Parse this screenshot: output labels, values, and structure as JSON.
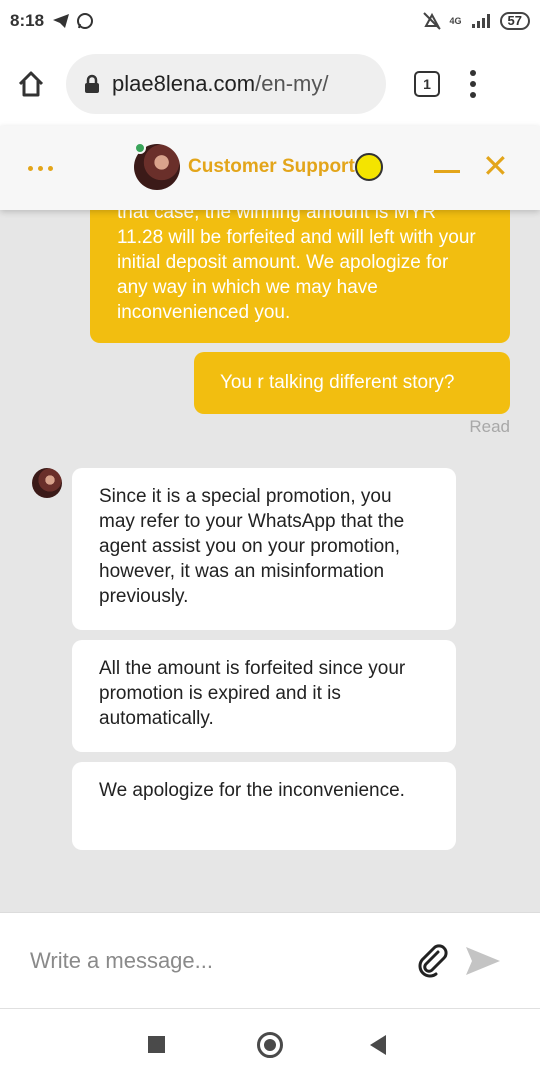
{
  "status_bar": {
    "time": "8:18",
    "network": "4G",
    "battery": "57"
  },
  "browser": {
    "url_domain": "plae8lena.com",
    "url_path": "/en-my/",
    "tab_count": "1"
  },
  "chat_header": {
    "title": "Customer Support"
  },
  "messages": {
    "outgoing_1": "that case, the winning amount is MYR 11.28 will be forfeited and will left with your initial deposit amount. We apologize for any way in which we may have inconvenienced you.",
    "outgoing_2": "You r talking different story?",
    "read_status": "Read",
    "incoming_1": "Since it is a special promotion, you may refer to your WhatsApp that the agent assist you on your promotion, however, it was an misinformation previously.",
    "incoming_2": "All the amount is forfeited since your promotion is expired and it is automatically.",
    "incoming_3": "We apologize for the inconvenience."
  },
  "composer": {
    "placeholder": "Write a message..."
  },
  "icons": {
    "status": [
      "telegram-icon",
      "whatsapp-icon",
      "mute-icon",
      "signal-icon",
      "battery-icon"
    ],
    "browser": [
      "home-icon",
      "lock-icon",
      "tabs-icon",
      "menu-icon"
    ],
    "chat": [
      "more-icon",
      "minimize-icon",
      "close-icon",
      "attach-icon",
      "send-icon"
    ],
    "nav": [
      "recents-icon",
      "home-nav-icon",
      "back-icon"
    ]
  },
  "colors": {
    "accent": "#e3a51a",
    "outgoing_bubble": "#f2be10",
    "online": "#3aa45a",
    "chat_background": "#e6e6e6"
  }
}
